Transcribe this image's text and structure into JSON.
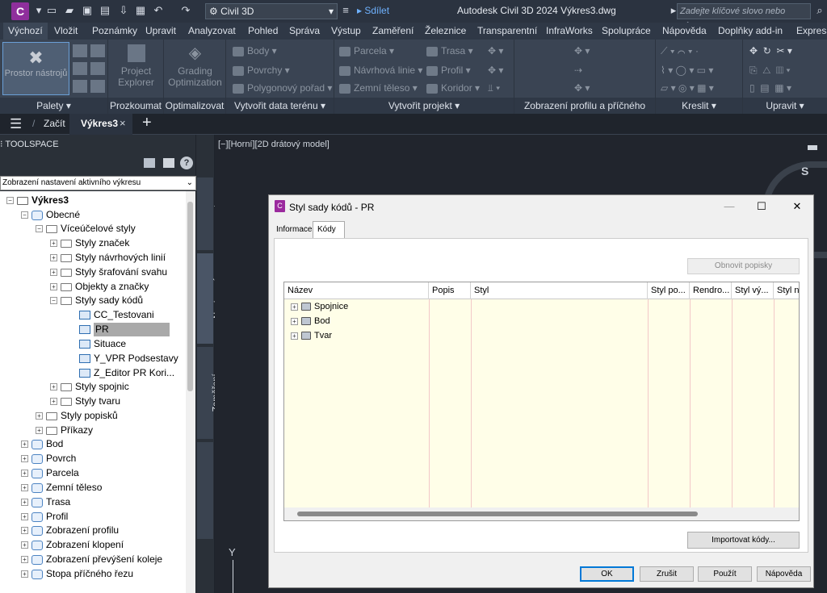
{
  "app": {
    "logo_letter": "C",
    "workspace": "Civil 3D",
    "share": "Sdílet",
    "title": "Autodesk Civil 3D 2024   Výkres3.dwg",
    "search_placeholder": "Zadejte klíčové slovo nebo výraz."
  },
  "ribbon_tabs": [
    "Výchozí",
    "Vložit",
    "Poznámky",
    "Upravit",
    "Analyzovat",
    "Pohled",
    "Správa",
    "Výstup",
    "Zaměření",
    "Železnice",
    "Transparentní",
    "InfraWorks",
    "Spolupráce",
    "Nápověda",
    "Doplňky add-in",
    "Express"
  ],
  "ribbon": {
    "palettes": {
      "big_label": "Prostor nástrojů",
      "footer": "Palety ▾"
    },
    "explore": {
      "big_label": "Project Explorer",
      "footer": "Prozkoumat"
    },
    "optimize": {
      "big_label": "Grading Optimization",
      "footer": "Optimalizovat"
    },
    "terrain": {
      "items": [
        "Body ▾",
        "Povrchy ▾",
        "Polygonový pořad ▾"
      ],
      "footer": "Vytvořit data terénu ▾"
    },
    "design": {
      "col1": [
        "Parcela ▾",
        "Návrhová linie ▾",
        "Zemní těleso ▾"
      ],
      "col2": [
        "Trasa ▾",
        "Profil ▾",
        "Koridor ▾"
      ],
      "footer": "Vytvořit projekt ▾"
    },
    "profile_view": {
      "footer": "Zobrazení profilu a příčného řezu"
    },
    "draw": {
      "footer": "Kreslit ▾"
    },
    "modify": {
      "footer": "Upravit ▾"
    }
  },
  "doc_tabs": {
    "start": "Začít",
    "active": "Výkres3",
    "close": "×",
    "add": "+",
    "menu": "☰",
    "sep": "/"
  },
  "toolspace": {
    "header": "⁝ TOOLSPACE",
    "filter": "Zobrazení nastavení aktivního výkresu",
    "tree": [
      {
        "label": "Výkres3",
        "bold": true
      },
      {
        "label": "Obecné"
      },
      {
        "label": "Víceúčelové styly"
      },
      {
        "label": "Styly značek"
      },
      {
        "label": "Styly návrhových linií"
      },
      {
        "label": "Styly šrafování svahu"
      },
      {
        "label": "Objekty a značky"
      },
      {
        "label": "Styly sady kódů"
      },
      {
        "label": "CC_Testovani"
      },
      {
        "label": "PR"
      },
      {
        "label": "Situace"
      },
      {
        "label": "Y_VPR Podsestavy"
      },
      {
        "label": "Z_Editor PR Kori..."
      },
      {
        "label": "Styly spojnic"
      },
      {
        "label": "Styly tvaru"
      },
      {
        "label": "Styly popisků"
      },
      {
        "label": "Příkazy"
      },
      {
        "label": "Bod"
      },
      {
        "label": "Povrch"
      },
      {
        "label": "Parcela"
      },
      {
        "label": "Zemní těleso"
      },
      {
        "label": "Trasa"
      },
      {
        "label": "Profil"
      },
      {
        "label": "Zobrazení profilu"
      },
      {
        "label": "Zobrazení klopení"
      },
      {
        "label": "Zobrazení převýšení koleje"
      },
      {
        "label": "Stopa příčného řezu"
      }
    ],
    "vertical_tabs": [
      "Prospektor",
      "Nastavení",
      "Zaměření",
      "Sada nástrojů"
    ]
  },
  "viewport": {
    "label": "[−][Horní][2D drátový model]",
    "compass_letter": "S",
    "axis_letter": "Y"
  },
  "dialog": {
    "title": "Styl sady kódů - PR",
    "tabs": [
      "Informace",
      "Kódy"
    ],
    "refresh_button": "Obnovit popisky",
    "columns": [
      "Název",
      "Popis",
      "Styl",
      "Styl po...",
      "Rendro...",
      "Styl vý...",
      "Styl n"
    ],
    "rows": [
      "Spojnice",
      "Bod",
      "Tvar"
    ],
    "import_button": "Importovat kódy...",
    "ok": "OK",
    "cancel": "Zrušit",
    "apply": "Použít",
    "help": "Nápověda",
    "win_min": "—",
    "win_max": "☐",
    "win_close": "✕"
  }
}
